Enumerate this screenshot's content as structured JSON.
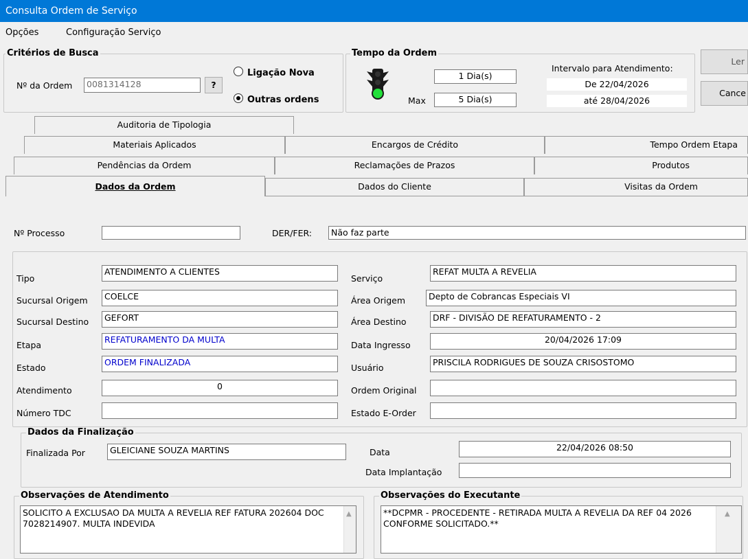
{
  "window": {
    "title": "Consulta Ordem de Serviço"
  },
  "menu": [
    "Opções",
    "Configuração Serviço"
  ],
  "criteria": {
    "title": "Critérios de Busca",
    "order_label": "Nº da Ordem",
    "order_value": "0081314128",
    "help_button": "?",
    "radio_new": "Ligação Nova",
    "radio_other": "Outras ordens",
    "selected": "Outras ordens"
  },
  "tempo": {
    "title": "Tempo da Ordem",
    "value1": "1 Dia(s)",
    "max_label": "Max",
    "value2": "5 Dia(s)",
    "interval_label": "Intervalo para Atendimento:",
    "from": "De  22/04/2026",
    "to": "até 28/04/2026",
    "light": "green"
  },
  "buttons": {
    "ler": "Ler",
    "cancel": "Cance"
  },
  "tabs": {
    "row4": [
      "Auditoria de Tipologia"
    ],
    "row3": [
      "Materiais Aplicados",
      "Encargos de Crédito",
      "Tempo Ordem Etapa"
    ],
    "row2": [
      "Pendências da Ordem",
      "Reclamações de Prazos",
      "Produtos"
    ],
    "row1": [
      "Dados da Ordem",
      "Dados do Cliente",
      "Visitas da Ordem"
    ],
    "active": "Dados da Ordem"
  },
  "form": {
    "processo_label": "Nº Processo",
    "processo_value": "",
    "derfer_label": "DER/FER:",
    "derfer_value": "Não faz parte",
    "tipo_label": "Tipo",
    "tipo_value": "ATENDIMENTO A CLIENTES",
    "sucursal_origem_label": "Sucursal Origem",
    "sucursal_origem_value": "COELCE",
    "sucursal_destino_label": "Sucursal Destino",
    "sucursal_destino_value": "GEFORT",
    "etapa_label": "Etapa",
    "etapa_value": "REFATURAMENTO DA MULTA",
    "estado_label": "Estado",
    "estado_value": "ORDEM FINALIZADA",
    "atendimento_label": "Atendimento",
    "atendimento_value": "0",
    "tdc_label": "Número TDC",
    "tdc_value": "",
    "servico_label": "Serviço",
    "servico_value": "REFAT MULTA A REVELIA",
    "area_origem_label": "Área Origem",
    "area_origem_value": "Depto de Cobrancas Especiais VI",
    "area_destino_label": "Área Destino",
    "area_destino_value": "DRF - DIVISÃO DE REFATURAMENTO - 2",
    "data_ingresso_label": "Data Ingresso",
    "data_ingresso_value": "20/04/2026 17:09",
    "usuario_label": "Usuário",
    "usuario_value": "PRISCILA RODRIGUES DE SOUZA CRISOSTOMO",
    "ordem_original_label": "Ordem Original",
    "ordem_original_value": "",
    "estado_eorder_label": "Estado E-Order",
    "estado_eorder_value": ""
  },
  "finalizacao": {
    "title": "Dados da Finalização",
    "por_label": "Finalizada Por",
    "por_value": "GLEICIANE SOUZA MARTINS",
    "data_label": "Data",
    "data_value": "22/04/2026 08:50",
    "implantacao_label": "Data Implantação",
    "implantacao_value": ""
  },
  "obs_atendimento": {
    "title": "Observações de Atendimento",
    "text": "SOLICITO A EXCLUSAO DA MULTA A REVELIA REF FATURA 202604 DOC 7028214907. MULTA INDEVIDA"
  },
  "obs_executante": {
    "title": "Observações do Executante",
    "text": "**DCPMR - PROCEDENTE - RETIRADA MULTA A REVELIA DA REF 04 2026 CONFORME SOLICITADO.**"
  }
}
